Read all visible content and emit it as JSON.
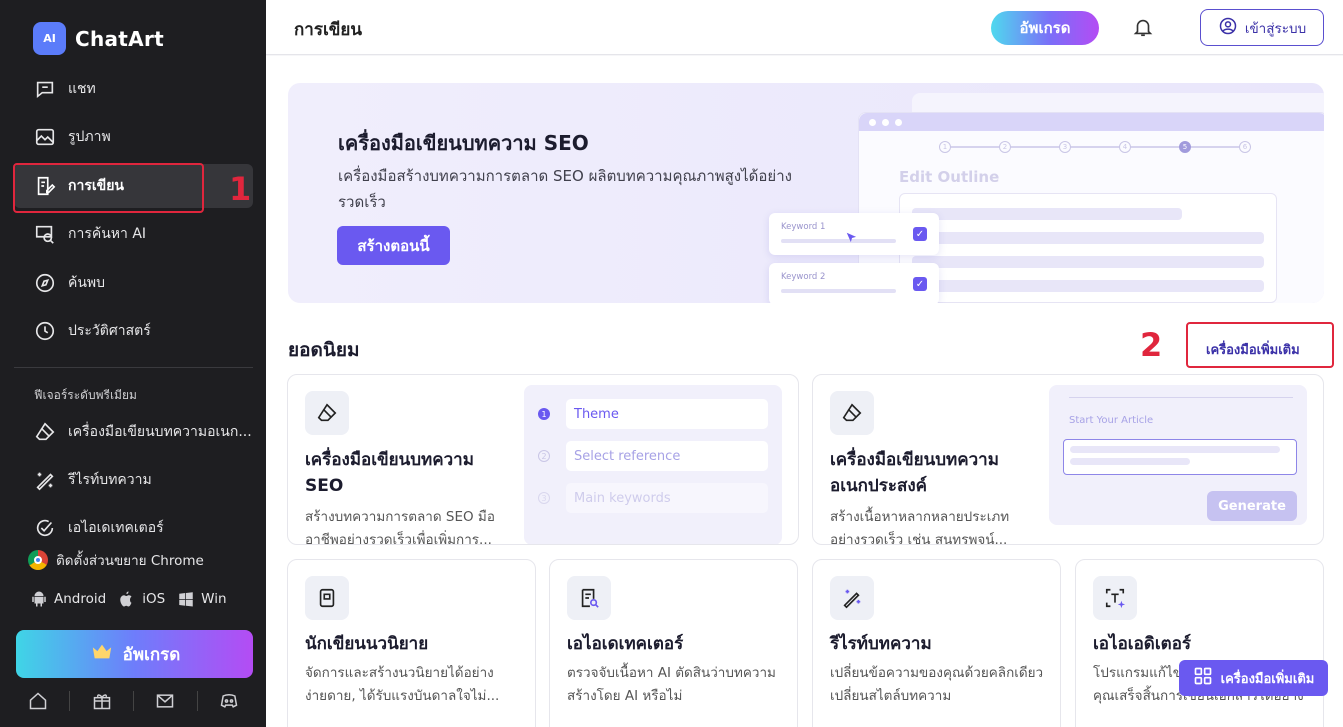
{
  "app": {
    "name": "ChatArt",
    "logo_mark": "AI"
  },
  "sidebar": {
    "items": [
      {
        "label": "แชท",
        "icon": "chat-icon"
      },
      {
        "label": "รูปภาพ",
        "icon": "image-icon"
      },
      {
        "label": "การเขียน",
        "icon": "writing-icon"
      },
      {
        "label": "การค้นหา AI",
        "icon": "ai-search-icon"
      },
      {
        "label": "ค้นพบ",
        "icon": "compass-icon"
      },
      {
        "label": "ประวัติศาสตร์",
        "icon": "history-icon"
      }
    ],
    "premium_header": "ฟีเจอร์ระดับพรีเมียม",
    "premium_items": [
      {
        "label": "เครื่องมือเขียนบทความอเนก...",
        "icon": "eraser-icon"
      },
      {
        "label": "รีไรท์บทความ",
        "icon": "rewrite-icon"
      },
      {
        "label": "เอไอเดเทคเตอร์",
        "icon": "check-circle-icon"
      }
    ],
    "chrome_ext": "ติดตั้งส่วนขยาย Chrome",
    "platforms": [
      "Android",
      "iOS",
      "Win"
    ],
    "upgrade": "อัพเกรด"
  },
  "annotations": {
    "one": "1",
    "two": "2"
  },
  "topbar": {
    "title": "การเขียน",
    "upgrade": "อัพเกรด",
    "login": "เข้าสู่ระบบ"
  },
  "hero": {
    "title": "เครื่องมือเขียนบทความ SEO",
    "subtitle": "เครื่องมือสร้างบทความการตลาด SEO ผลิตบทความคุณภาพสูงได้อย่างรวดเร็ว",
    "cta": "สร้างตอนนี้",
    "preview": {
      "steps": [
        "1",
        "2",
        "3",
        "4",
        "5",
        "6"
      ],
      "heading": "Edit Outline",
      "keyword1": "Keyword 1",
      "keyword2": "Keyword 2"
    }
  },
  "popular": {
    "title": "ยอดนิยม",
    "more": "เครื่องมือเพิ่มเติม",
    "cards": [
      {
        "title": "เครื่องมือเขียนบทความ SEO",
        "desc": "สร้างบทความการตลาด SEO มืออาชีพอย่างรวดเร็วเพื่อเพิ่มการ...",
        "panel": [
          "Theme",
          "Select reference",
          "Main keywords"
        ]
      },
      {
        "title": "เครื่องมือเขียนบทความอเนกประสงค์",
        "desc": "สร้างเนื้อหาหลากหลายประเภทอย่างรวดเร็ว เช่น สุนทรพจน์...",
        "panel_heading": "Start Your Article",
        "panel_button": "Generate"
      },
      {
        "title": "นักเขียนนวนิยาย",
        "desc": "จัดการและสร้างนวนิยายได้อย่างง่ายดาย, ได้รับแรงบันดาลใจไม่..."
      },
      {
        "title": "เอไอเดเทคเตอร์",
        "desc": "ตรวจจับเนื้อหา AI ตัดสินว่าบทความสร้างโดย AI หรือไม่"
      },
      {
        "title": "รีไรท์บทความ",
        "desc": "เปลี่ยนข้อความของคุณด้วยคลิกเดียว เปลี่ยนสไตล์บทความ"
      },
      {
        "title": "เอไอเอดิเตอร์",
        "desc": "โปรแกรมแก้ไขเอกสาร AI ช่วยให้คุณเสร็จสิ้นการเขียนเอกสารได้อย่าง"
      }
    ]
  },
  "floating": {
    "label": "เครื่องมือเพิ่มเติม"
  }
}
